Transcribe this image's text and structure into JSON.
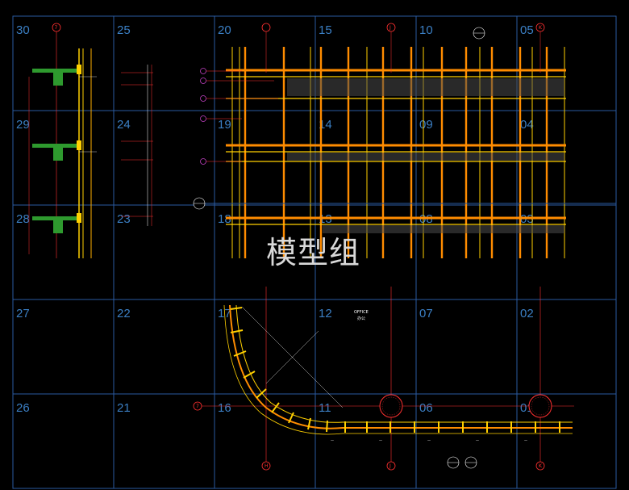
{
  "grid_cells": [
    "30",
    "25",
    "20",
    "15",
    "10",
    "05",
    "29",
    "24",
    "19",
    "14",
    "09",
    "04",
    "28",
    "23",
    "18",
    "13",
    "08",
    "03",
    "27",
    "22",
    "17",
    "12",
    "07",
    "02",
    "26",
    "21",
    "16",
    "11",
    "06",
    "01"
  ],
  "grid_colors": {
    "border": "#2a5aa0",
    "cell_text": "#3b7fc4",
    "background": "#000000"
  },
  "watermark": "模型组",
  "axis_bubbles": {
    "top_left": "7",
    "top_mid": "J",
    "top_right": "K",
    "bottom_h": "H",
    "bottom_j": "J",
    "bottom_k": "K",
    "left_7": "7",
    "plan_h": "H"
  },
  "plan_labels": {
    "office_en": "OFFICE",
    "office_cn": "办公"
  },
  "icon_names": [
    "section-bubble-icon",
    "axis-bubble-icon",
    "column-section-icon"
  ]
}
